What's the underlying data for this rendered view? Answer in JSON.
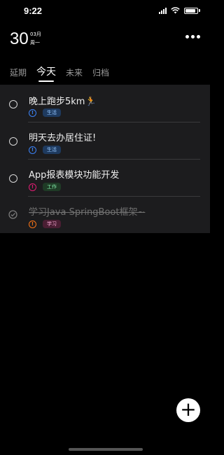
{
  "status_bar": {
    "time": "9:22"
  },
  "header": {
    "day": "30",
    "month": "03月",
    "weekday": "周一",
    "more_icon": "ellipsis-icon"
  },
  "tabs": [
    {
      "label": "延期",
      "active": false
    },
    {
      "label": "今天",
      "active": true
    },
    {
      "label": "未来",
      "active": false
    },
    {
      "label": "归档",
      "active": false
    }
  ],
  "tasks": [
    {
      "title": "晚上跑步5km🏃",
      "priority_color": "#3b82f6",
      "tag": "生活",
      "tag_color": "#3b82f6",
      "done": false
    },
    {
      "title": "明天去办居住证!",
      "priority_color": "#3b82f6",
      "tag": "生活",
      "tag_color": "#3b82f6",
      "done": false
    },
    {
      "title": "App报表模块功能开发",
      "priority_color": "#e11d74",
      "tag": "工作",
      "tag_color": "#22c55e",
      "done": false
    },
    {
      "title": "学习Java SpringBoot框架~",
      "priority_color": "#f97316",
      "tag": "学习",
      "tag_color": "#ec4899",
      "done": true
    }
  ],
  "fab": {
    "icon": "plus-icon",
    "label": "+"
  }
}
